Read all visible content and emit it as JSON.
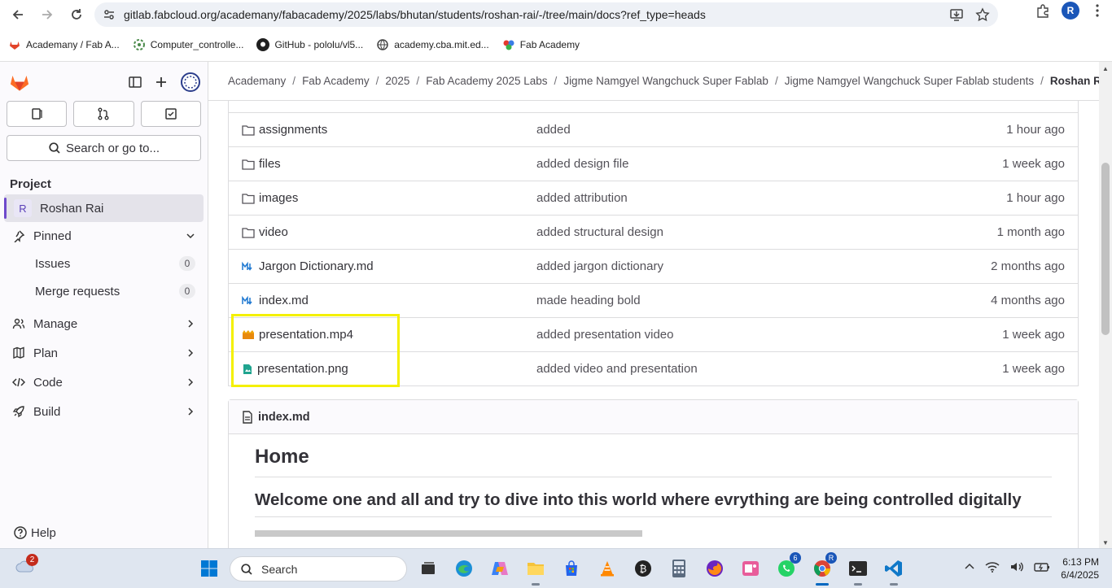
{
  "browser": {
    "url": "gitlab.fabcloud.org/academany/fabacademy/2025/labs/bhutan/students/roshan-rai/-/tree/main/docs?ref_type=heads",
    "profile_initial": "R",
    "bookmarks": [
      {
        "label": "Academany / Fab A...",
        "icon": "gitlab-icon"
      },
      {
        "label": "Computer_controlle...",
        "icon": "gear-icon"
      },
      {
        "label": "GitHub - pololu/vl5...",
        "icon": "github-icon"
      },
      {
        "label": "academy.cba.mit.ed...",
        "icon": "globe-icon"
      },
      {
        "label": "Fab Academy",
        "icon": "fab-icon"
      }
    ]
  },
  "sidebar": {
    "search_label": "Search or go to...",
    "section_title": "Project",
    "project_initial": "R",
    "project_name": "Roshan Rai",
    "pinned": "Pinned",
    "issues": {
      "label": "Issues",
      "count": "0"
    },
    "merge_requests": {
      "label": "Merge requests",
      "count": "0"
    },
    "items": [
      {
        "label": "Manage",
        "icon": "users-icon"
      },
      {
        "label": "Plan",
        "icon": "plan-icon"
      },
      {
        "label": "Code",
        "icon": "code-icon"
      },
      {
        "label": "Build",
        "icon": "rocket-icon"
      }
    ],
    "help": "Help"
  },
  "breadcrumb": [
    "Academany",
    "Fab Academy",
    "2025",
    "Fab Academy 2025 Labs",
    "Jigme Namgyel Wangchuck Super Fablab",
    "Jigme Namgyel Wangchuck Super Fablab students",
    "Roshan Rai"
  ],
  "files": [
    {
      "name": "assignments",
      "type": "folder",
      "message": "added",
      "time": "1 hour ago"
    },
    {
      "name": "files",
      "type": "folder",
      "message": "added design file",
      "time": "1 week ago"
    },
    {
      "name": "images",
      "type": "folder",
      "message": "added attribution",
      "time": "1 hour ago"
    },
    {
      "name": "video",
      "type": "folder",
      "message": "added structural design",
      "time": "1 month ago"
    },
    {
      "name": "Jargon Dictionary.md",
      "type": "markdown",
      "message": "added jargon dictionary",
      "time": "2 months ago"
    },
    {
      "name": "index.md",
      "type": "markdown",
      "message": "made heading bold",
      "time": "4 months ago"
    },
    {
      "name": "presentation.mp4",
      "type": "video",
      "message": "added presentation video",
      "time": "1 week ago"
    },
    {
      "name": "presentation.png",
      "type": "image",
      "message": "added video and presentation",
      "time": "1 week ago"
    }
  ],
  "readme": {
    "filename": "index.md",
    "h1": "Home",
    "h2": "Welcome one and all and try to dive into this world where evrything are being controlled digitally"
  },
  "taskbar": {
    "weather_badge": "2",
    "search": "Search",
    "whatsapp_badge": "6",
    "chrome_badge": "R",
    "time": "6:13 PM",
    "date": "6/4/2025"
  },
  "colors": {
    "gitlab_purple": "#6e49cb",
    "highlight": "#f4f000",
    "folder": "#535158"
  }
}
